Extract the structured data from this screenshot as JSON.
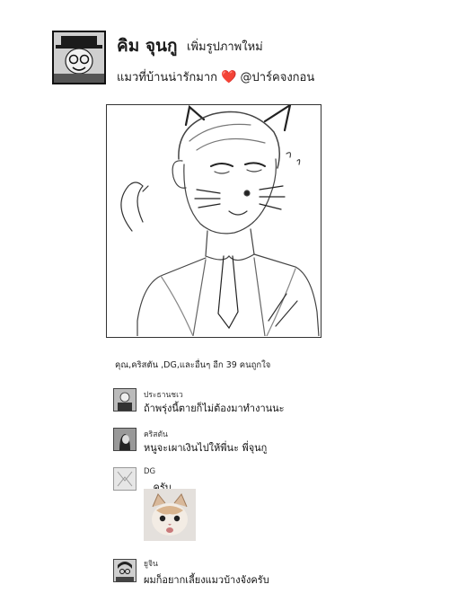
{
  "post": {
    "poster_name": "คิม จุนกู",
    "action": "เพิ่มรูปภาพใหม่",
    "caption": "แมวที่บ้านน่ารักมาก",
    "caption_mention": "@ปาร์คจงกอน",
    "heart_icon": "❤️",
    "likes_text": "คุณ,คริสตัน ,DG,และอื่นๆ อีก 39 คนถูกใจ"
  },
  "comments": [
    {
      "name": "ประธานชเว",
      "text": "ถ้าพรุ่งนี้ตายก็ไม่ต้องมาทำงานนะ"
    },
    {
      "name": "คริสตัน",
      "text": "หนูจะเผาเงินไปให้พี่นะ พี่จุนกู"
    },
    {
      "name": "DG",
      "text": "...ครับ",
      "attachment": "cat-photo"
    },
    {
      "name": "ยูจิน",
      "text": "ผมก็อยากเลี้ยงแมวบ้างจังครับ"
    }
  ]
}
